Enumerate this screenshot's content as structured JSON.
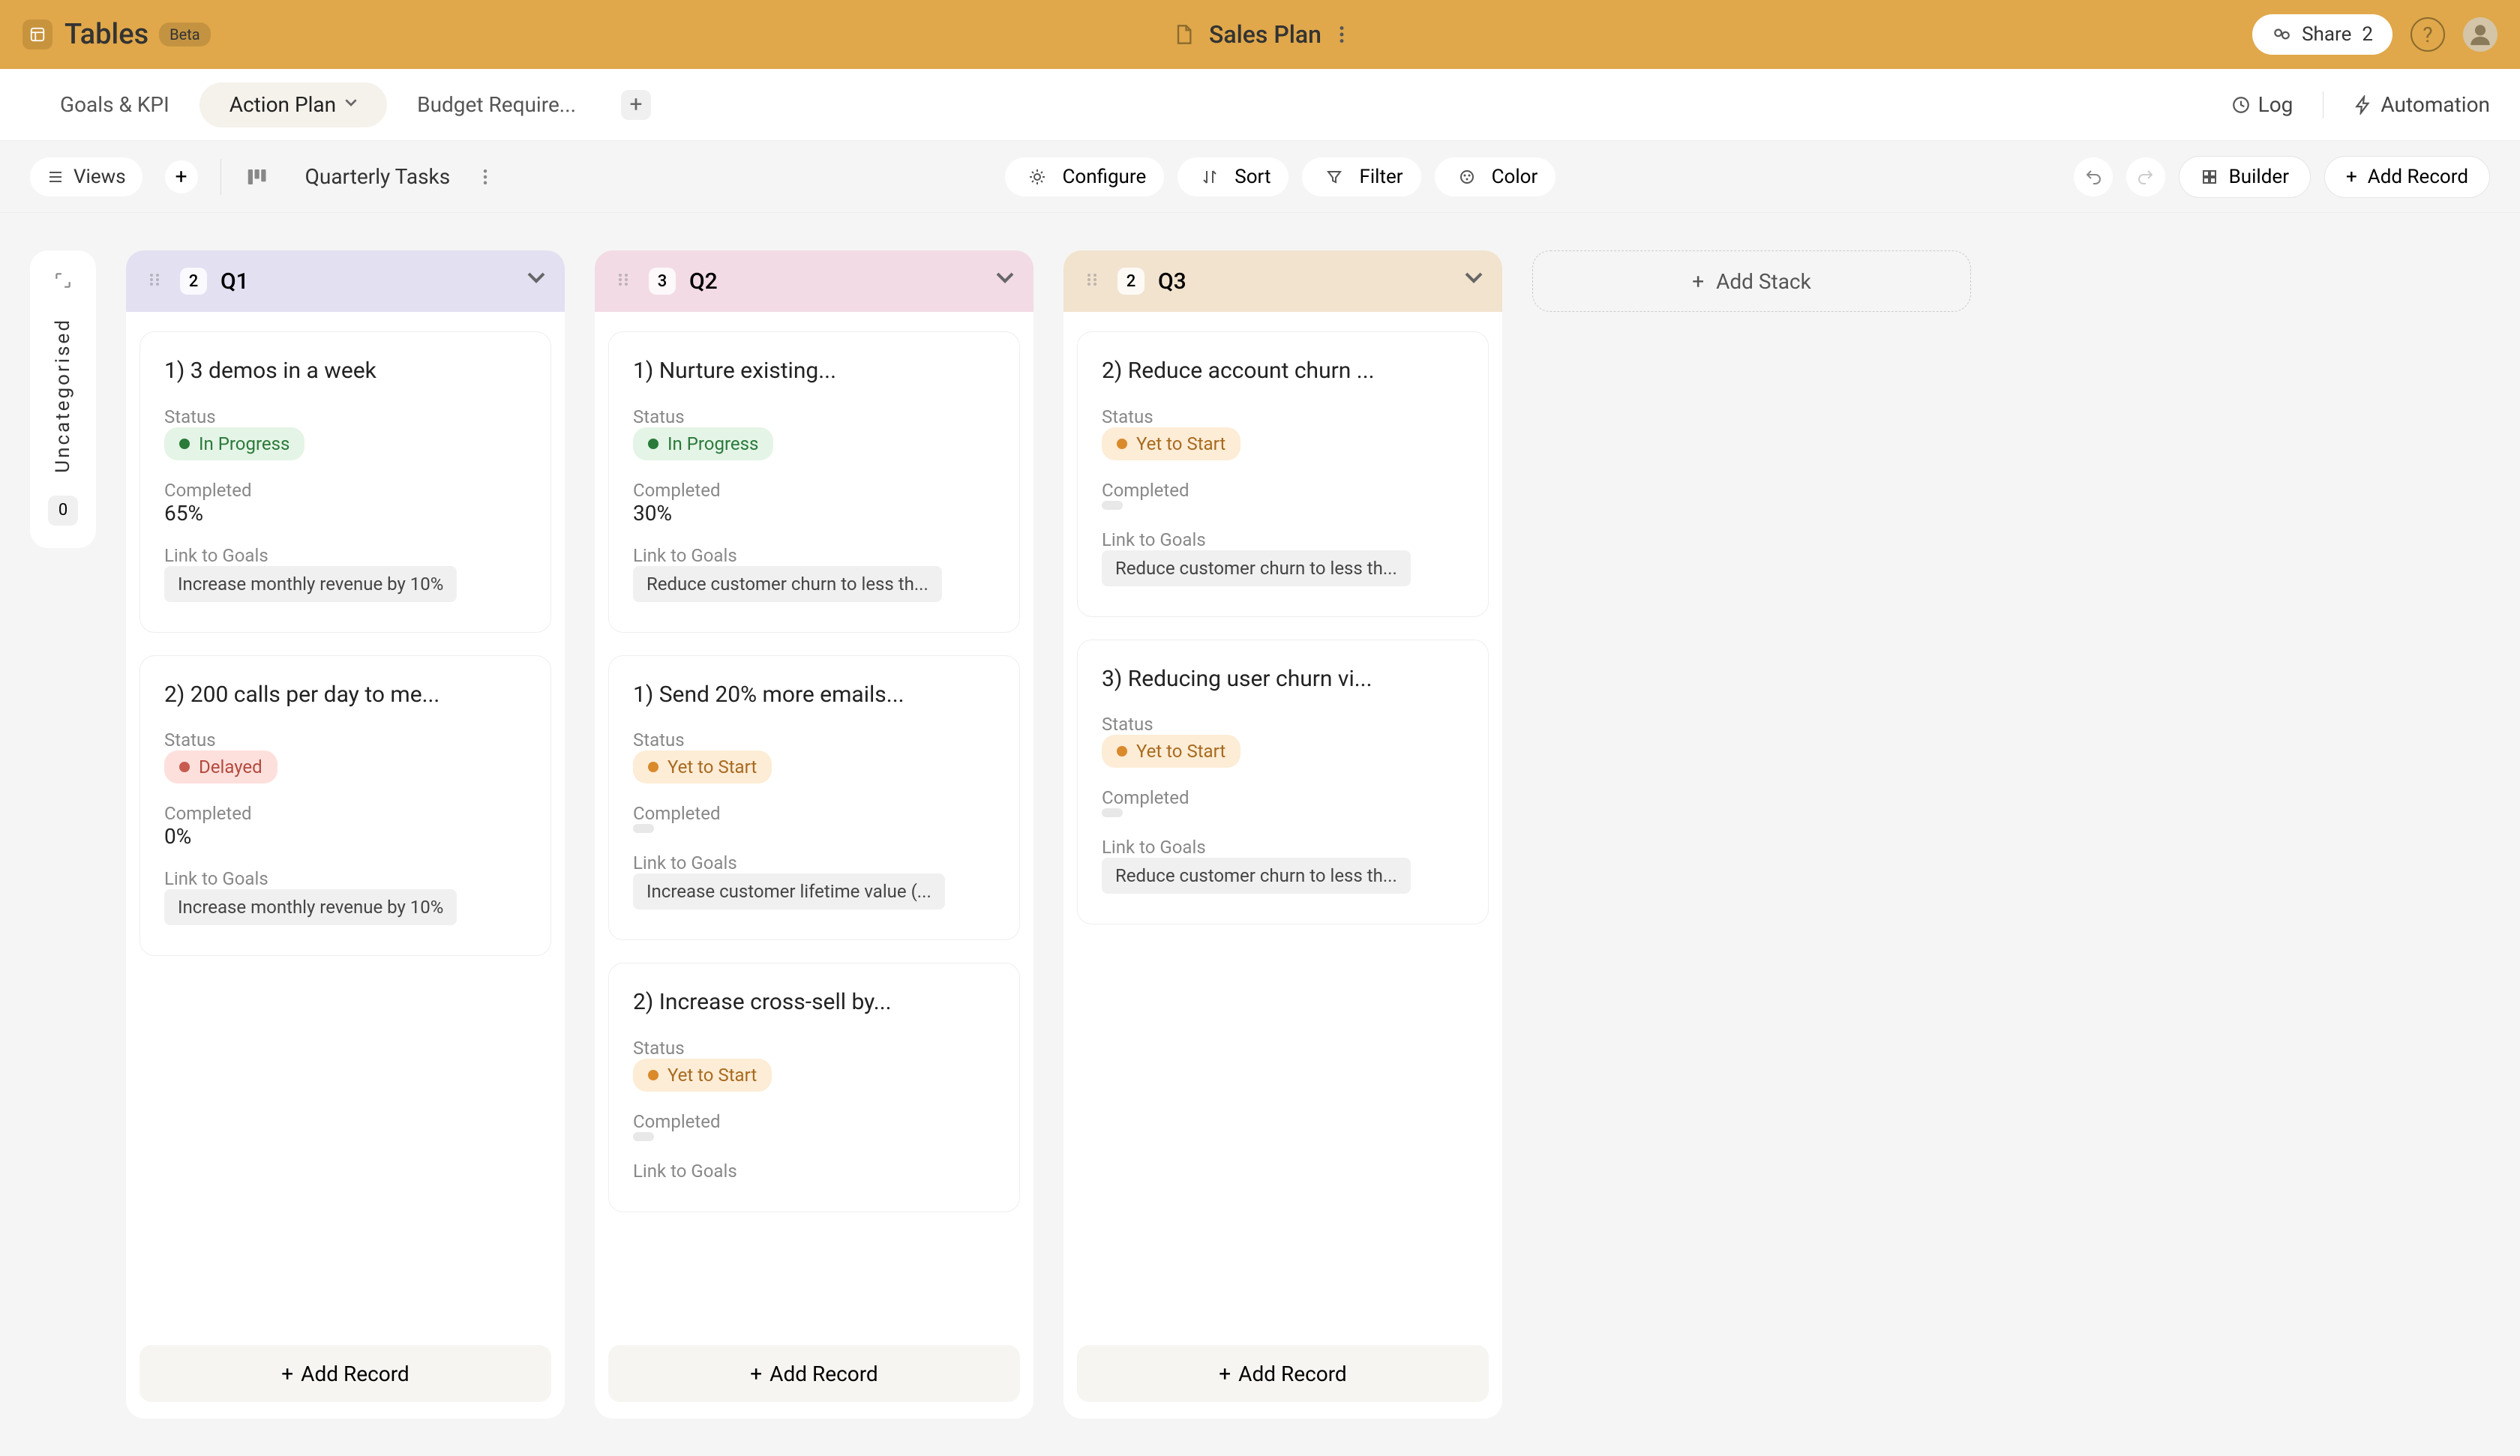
{
  "brand": {
    "name": "Tables",
    "beta": "Beta"
  },
  "doc": {
    "title": "Sales Plan"
  },
  "top": {
    "share_label": "Share",
    "share_count": "2"
  },
  "tabs": {
    "items": [
      {
        "label": "Goals & KPI",
        "active": false
      },
      {
        "label": "Action Plan",
        "active": true
      },
      {
        "label": "Budget Require...",
        "active": false
      }
    ],
    "log_label": "Log",
    "automation_label": "Automation"
  },
  "toolbar": {
    "views_label": "Views",
    "board_name": "Quarterly Tasks",
    "configure": "Configure",
    "sort": "Sort",
    "filter": "Filter",
    "color": "Color",
    "builder": "Builder",
    "add_record": "Add Record"
  },
  "uncat": {
    "label": "Uncategorised",
    "count": "0"
  },
  "stacks": [
    {
      "id": "q1",
      "name": "Q1",
      "count": "2",
      "head_class": "q1-head",
      "cards": [
        {
          "title": "1) 3 demos in a week",
          "status": {
            "label": "In Progress",
            "class": "status-inprogress"
          },
          "completed": "65%",
          "goal": "Increase monthly revenue by 10%"
        },
        {
          "title": "2) 200 calls per day to me...",
          "status": {
            "label": "Delayed",
            "class": "status-delayed"
          },
          "completed": "0%",
          "goal": "Increase monthly revenue by 10%"
        }
      ],
      "add_record_label": "Add Record"
    },
    {
      "id": "q2",
      "name": "Q2",
      "count": "3",
      "head_class": "q2-head",
      "cards": [
        {
          "title": "1) Nurture existing...",
          "status": {
            "label": "In Progress",
            "class": "status-inprogress"
          },
          "completed": "30%",
          "goal": "Reduce customer churn to less th..."
        },
        {
          "title": "1) Send 20% more emails...",
          "status": {
            "label": "Yet to Start",
            "class": "status-yet"
          },
          "completed": "",
          "goal": "Increase customer lifetime value (..."
        },
        {
          "title": "2) Increase cross-sell by...",
          "status": {
            "label": "Yet to Start",
            "class": "status-yet"
          },
          "completed": "",
          "goal": ""
        }
      ],
      "add_record_label": "Add Record"
    },
    {
      "id": "q3",
      "name": "Q3",
      "count": "2",
      "head_class": "q3-head",
      "cards": [
        {
          "title": "2) Reduce account churn ...",
          "status": {
            "label": "Yet to Start",
            "class": "status-yet"
          },
          "completed": "",
          "goal": "Reduce customer churn to less th..."
        },
        {
          "title": "3) Reducing user churn vi...",
          "status": {
            "label": "Yet to Start",
            "class": "status-yet"
          },
          "completed": "",
          "goal": "Reduce customer churn to less th..."
        }
      ],
      "add_record_label": "Add Record"
    }
  ],
  "labels": {
    "status": "Status",
    "completed": "Completed",
    "link_to_goals": "Link to Goals",
    "add_stack": "Add Stack"
  }
}
